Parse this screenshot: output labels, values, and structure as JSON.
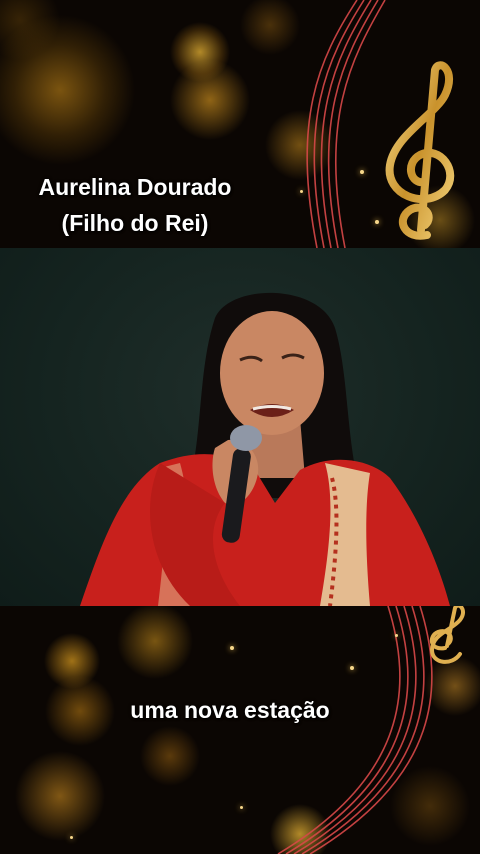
{
  "overlay": {
    "artist": "Aurelina Dourado",
    "song": "(Filho do Rei)"
  },
  "lyrics": {
    "current_line": "uma nova estação"
  },
  "colors": {
    "accent_gold": "#e0b050",
    "staff_red": "#d84848",
    "shirt_red": "#c8201c",
    "background": "#0b0603"
  },
  "icons": [
    "treble-clef-icon",
    "music-staff-icon"
  ]
}
